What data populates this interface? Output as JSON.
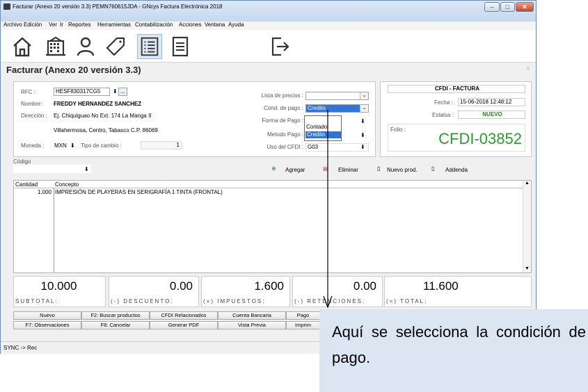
{
  "window": {
    "title": "Facturar (Anexo 20 versión 3.3) PEMN760615JDA - GNcys Factura Electrónica 2018"
  },
  "menu": [
    "Archivo",
    "Edición",
    "Ver",
    "Ir",
    "Reportes",
    "Herramientas",
    "Contabilización",
    "Acciones",
    "Ventana",
    "Ayuda"
  ],
  "toolbar_icons": [
    "home-icon",
    "building-icon",
    "user-icon",
    "tag-icon",
    "list-icon",
    "document-icon",
    "logout-icon"
  ],
  "page": {
    "title": "Facturar (Anexo 20 versión 3.3)",
    "close": "×"
  },
  "client": {
    "rfc_label": "RFC :",
    "rfc": "HESF830317CG5",
    "rfc_btn": "...",
    "nombre_label": "Nombre :",
    "nombre": "FREDDY HERNANDEZ SANCHEZ",
    "direccion_label": "Dirección :",
    "direccion1": "Ej. Chiquiguao No Ext. 174 La Manga II",
    "direccion2": "Villahermosa, Centro, Tabasco C.P. 86069",
    "moneda_label": "Moneda :",
    "moneda": "MXN",
    "tipo_cambio_label": "Tipo de cambio :",
    "tipo_cambio": "1"
  },
  "payment": {
    "lista_label": "Lista de precios :",
    "lista": "",
    "cond_label": "Cond. de pago :",
    "cond": "Credito",
    "forma_label": "Forma de Pago :",
    "forma": "",
    "metodo_label": "Metodo Pago :",
    "metodo": "",
    "uso_label": "Uso del CFDI :",
    "uso": "G03",
    "options": [
      "Contado",
      "Credito"
    ]
  },
  "cfdi": {
    "type": "CFDI - FACTURA",
    "fecha_label": "Fecha :",
    "fecha": "15-06-2018 12:48:12",
    "estatus_label": "Estatus :",
    "estatus": "NUEVO",
    "folio_label": "Folio :",
    "folio": "CFDI-03852"
  },
  "codigo": {
    "label": "Código",
    "value": ""
  },
  "actions": {
    "agregar": "Agregar",
    "eliminar": "Eliminar",
    "nuevo_prod": "Nuevo prod.",
    "addenda": "Addenda"
  },
  "grid": {
    "headers": [
      "Cantidad",
      "Concepto"
    ],
    "rows": [
      {
        "cantidad": "1.000",
        "concepto": "IMPRESIÓN DE PLAYERAS EN SERIGRAFÍA 1 TINTA (FRONTAL)"
      }
    ]
  },
  "totals": [
    {
      "label": "SUBTOTAL:",
      "value": "10.000"
    },
    {
      "label": "(-) DESCUENTO:",
      "value": "0.00"
    },
    {
      "label": "(+) IMPUESTOS:",
      "value": "1.600"
    },
    {
      "label": "(-) RETENCIONES:",
      "value": "0.00"
    },
    {
      "label": "(=) TOTAL:",
      "value": "11.600"
    }
  ],
  "fkeys_row1": [
    "Nuevo",
    "F2: Buscar productos",
    "CFDI Relacionados",
    "Cuenta Bancaria",
    "Pago"
  ],
  "fkeys_row2": [
    "F7: Observaciones",
    "F8: Cancelar",
    "Generar PDF",
    "Vista Previa",
    "Imprim"
  ],
  "status": "SYNC -> Rec",
  "callout": "Aquí se selecciona la condición de pago.",
  "colors": {
    "folio": "#2e9b2e",
    "estatus": "#1a8a1a",
    "selection": "#3375d6",
    "callout_bg": "#dce6f2"
  }
}
